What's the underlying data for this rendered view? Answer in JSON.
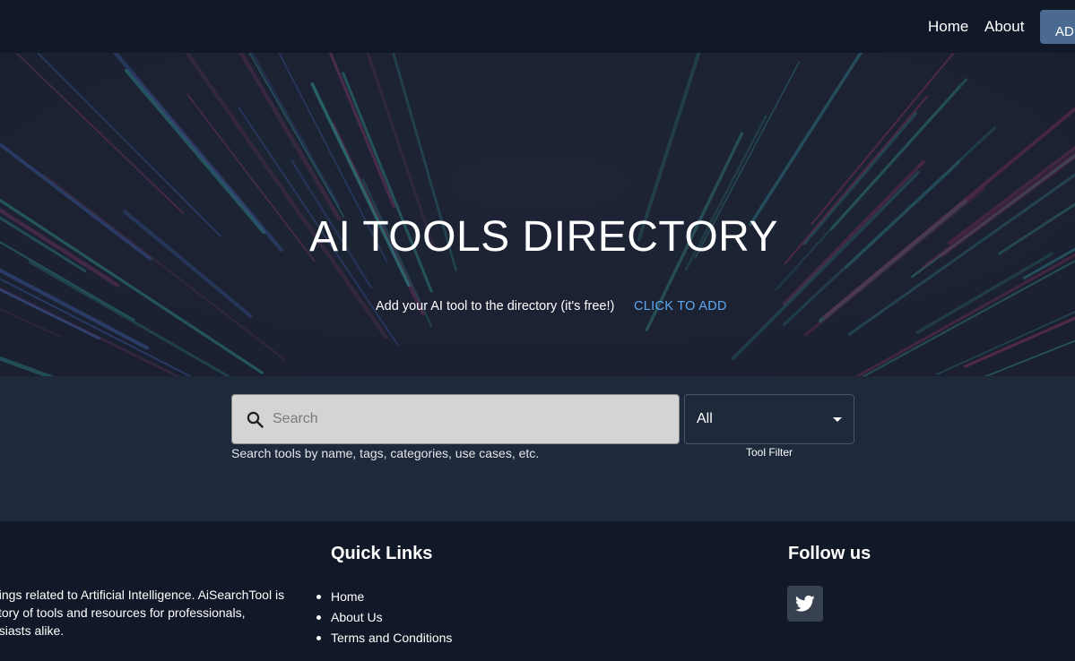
{
  "nav": {
    "links": [
      "Home",
      "About"
    ],
    "cta_label": "ADD"
  },
  "hero": {
    "title": "AI TOOLS DIRECTORY",
    "subtitle": "Add your AI tool to the directory (it's free!)",
    "cta": "CLICK TO ADD"
  },
  "search": {
    "icon": "search-icon",
    "placeholder": "Search",
    "value": "",
    "help": "Search tools by name, tags, categories, use cases, etc.",
    "filter": {
      "value": "All",
      "label": "Tool Filter"
    }
  },
  "footer": {
    "about_lines": [
      "hings related to Artificial Intelligence. AiSearchTool is",
      "ctory of tools and resources for professionals,",
      "usiasts alike."
    ],
    "quick_links": {
      "title": "Quick Links",
      "items": [
        "Home",
        "About Us",
        "Terms and Conditions"
      ]
    },
    "follow": {
      "title": "Follow us",
      "icon": "twitter-icon"
    }
  },
  "colors": {
    "nav_bg": "#111827",
    "search_bg": "#1e293b",
    "accent_button": "#4b6a92",
    "link_blue": "#5ea8f2"
  }
}
